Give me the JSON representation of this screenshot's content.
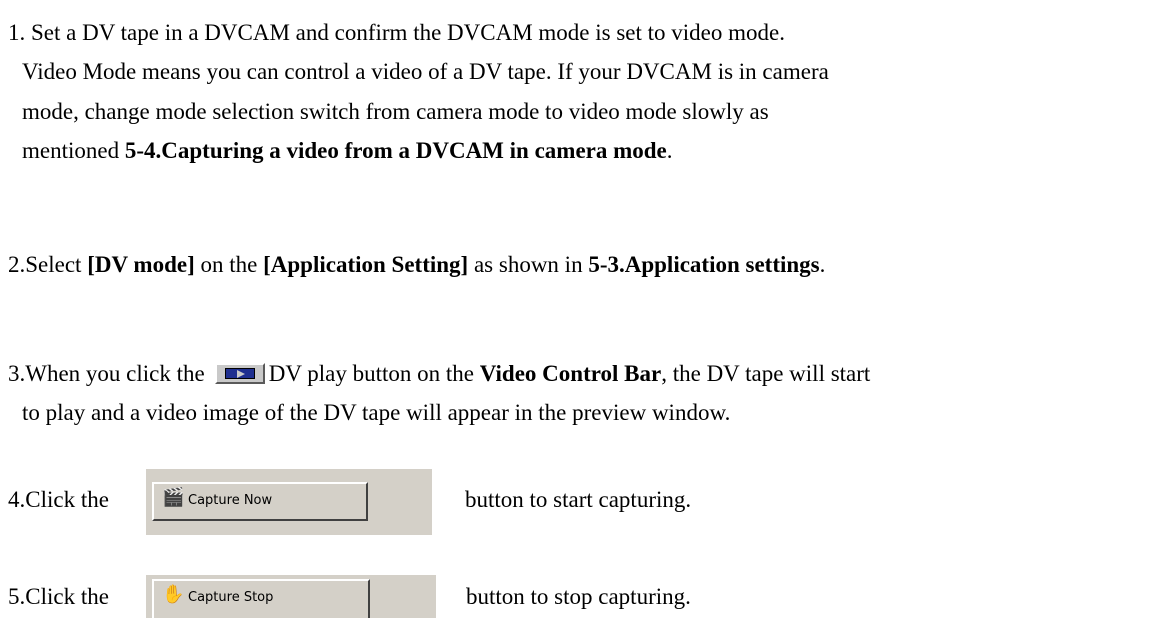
{
  "step1": {
    "line1": "1. Set a DV tape in a DVCAM and confirm the DVCAM mode is set to video mode.",
    "line2": "Video Mode means you can control a video of a DV tape. If your DVCAM is in camera",
    "line3": "mode, change mode selection switch from camera mode to video mode slowly as",
    "line4_pre": "mentioned ",
    "line4_bold": "5-4.Capturing a video from a DVCAM in camera mode",
    "line4_post": "."
  },
  "step2": {
    "pre": "2.Select ",
    "b1": "[DV mode]",
    "mid1": " on the ",
    "b2": "[Application Setting]",
    "mid2": " as shown in ",
    "b3": "5-3.Application settings",
    "post": "."
  },
  "step3": {
    "pre": "3.When you click the",
    "mid1": "DV play button on the ",
    "b1": "Video Control Bar",
    "post": ", the DV tape will start",
    "line2": "to play and a video image of the DV tape will appear in the preview window."
  },
  "step4": {
    "pre": "4.Click the",
    "button_label": "Capture Now",
    "post": "button to start capturing."
  },
  "step5": {
    "pre": "5.Click the",
    "button_label": "Capture Stop",
    "post": "button to stop capturing."
  },
  "icons": {
    "dv_play": "dv-play-icon",
    "capture_now": "clapperboard-icon",
    "capture_stop": "hand-icon"
  }
}
